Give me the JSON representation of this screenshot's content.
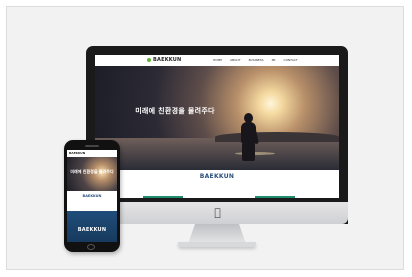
{
  "desktop": {
    "brand_logo": "BAEKKUN",
    "menu": [
      "HOME",
      "ABOUT",
      "BUSINESS",
      "PR",
      "CONTACT"
    ],
    "hero_headline": "미래에 친환경을 물려주다",
    "hero_sub": "",
    "brand_title": "BAEKKUN",
    "brand_sub": ""
  },
  "phone": {
    "brand_logo": "BAEKKUN",
    "hero_headline": "미래에 친환경을 물려주다",
    "brand_title": "BAEKKUN",
    "brand_sub": "",
    "bottom_text": "BAEKKUN"
  },
  "colors": {
    "accent_green": "#1f8c6e",
    "brand_blue": "#2a4f7a"
  }
}
